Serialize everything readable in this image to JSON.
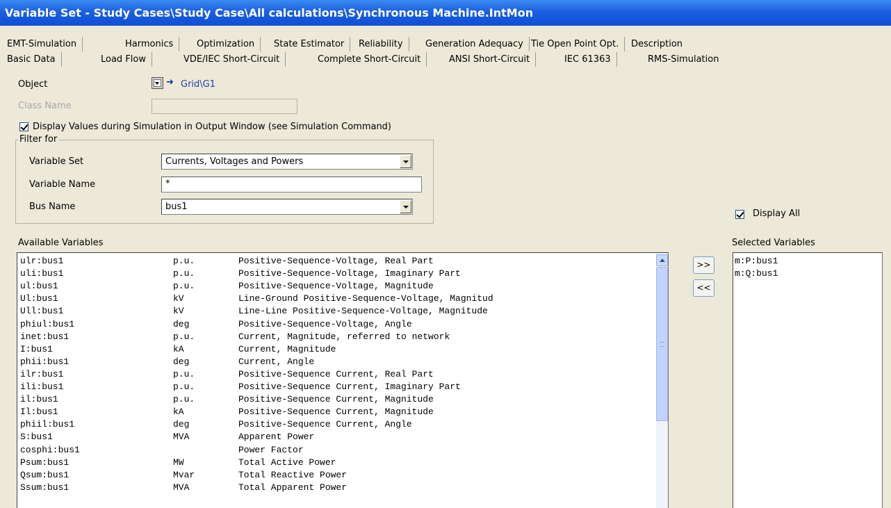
{
  "window": {
    "title": "Variable Set - Study Cases\\Study Case\\All calculations\\Synchronous Machine.IntMon"
  },
  "tabs_row1": [
    "EMT-Simulation",
    "Harmonics",
    "Optimization",
    "State Estimator",
    "Reliability",
    "Generation Adequacy",
    "Tie Open Point Opt.",
    "Description"
  ],
  "tabs_row2": [
    "Basic Data",
    "Load Flow",
    "VDE/IEC Short-Circuit",
    "Complete Short-Circuit",
    "ANSI Short-Circuit",
    "IEC 61363",
    "RMS-Simulation"
  ],
  "active_tab": "RMS-Simulation",
  "object": {
    "label": "Object",
    "value": "Grid\\G1",
    "select_icon": "dropdown-select-icon",
    "jump_icon": "right-arrow-icon"
  },
  "class_name": {
    "label": "Class Name",
    "value": ""
  },
  "display_values": {
    "label": "Display Values during Simulation in Output Window (see Simulation Command)",
    "checked": true
  },
  "filter": {
    "title": "Filter for",
    "variable_set_label": "Variable Set",
    "variable_set_value": "Currents, Voltages and Powers",
    "variable_name_label": "Variable Name",
    "variable_name_value": "*",
    "bus_name_label": "Bus Name",
    "bus_name_value": "bus1"
  },
  "display_all": {
    "label": "Display All",
    "checked": true
  },
  "available": {
    "label": "Available Variables",
    "rows": [
      [
        "ulr:bus1",
        "p.u.",
        "Positive-Sequence-Voltage, Real Part"
      ],
      [
        "uli:bus1",
        "p.u.",
        "Positive-Sequence-Voltage, Imaginary Part"
      ],
      [
        "ul:bus1",
        "p.u.",
        "Positive-Sequence-Voltage, Magnitude"
      ],
      [
        "Ul:bus1",
        "kV",
        "Line-Ground Positive-Sequence-Voltage, Magnitud"
      ],
      [
        "Ull:bus1",
        "kV",
        "Line-Line Positive-Sequence-Voltage, Magnitude"
      ],
      [
        "phiul:bus1",
        "deg",
        "Positive-Sequence-Voltage, Angle"
      ],
      [
        "inet:bus1",
        "p.u.",
        "Current, Magnitude, referred to network"
      ],
      [
        "I:bus1",
        "kA",
        "Current, Magnitude"
      ],
      [
        "phii:bus1",
        "deg",
        "Current, Angle"
      ],
      [
        "ilr:bus1",
        "p.u.",
        "Positive-Sequence Current, Real Part"
      ],
      [
        "ili:bus1",
        "p.u.",
        "Positive-Sequence Current, Imaginary Part"
      ],
      [
        "il:bus1",
        "p.u.",
        "Positive-Sequence Current, Magnitude"
      ],
      [
        "Il:bus1",
        "kA",
        "Positive-Sequence Current, Magnitude"
      ],
      [
        "phiil:bus1",
        "deg",
        "Positive-Sequence Current, Angle"
      ],
      [
        "S:bus1",
        "MVA",
        "Apparent Power"
      ],
      [
        "cosphi:bus1",
        "",
        "Power Factor"
      ],
      [
        "Psum:bus1",
        "MW",
        "Total Active Power"
      ],
      [
        "Qsum:bus1",
        "Mvar",
        "Total Reactive Power"
      ],
      [
        "Ssum:bus1",
        "MVA",
        "Total Apparent Power"
      ]
    ]
  },
  "buttons": {
    "add": ">>",
    "remove": "<<"
  },
  "selected": {
    "label": "Selected Variables",
    "items": [
      "m:P:bus1",
      "m:Q:bus1"
    ]
  }
}
